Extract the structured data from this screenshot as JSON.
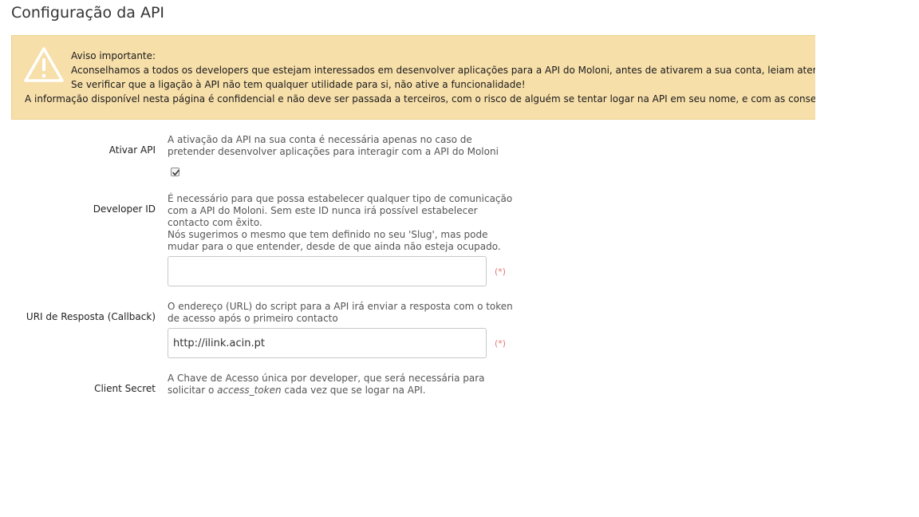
{
  "page": {
    "title": "Configuração da API"
  },
  "warning": {
    "icon": "warning-triangle-icon",
    "title": "Aviso importante:",
    "line1": "Aconselhamos a todos os developers que estejam interessados em desenvolver aplicações para a API do Moloni, antes de ativarem a sua conta, leiam atentamente",
    "line2": "Se verificar que a ligação à API não tem qualquer utilidade para si, não ative a funcionalidade!",
    "line3": "A informação disponível nesta página é confidencial e não deve ser passada a terceiros, com o risco de alguém se tentar logar na API em seu nome, e com as consequências"
  },
  "fields": {
    "activate": {
      "label": "Ativar API",
      "help_line1": "A ativação da API na sua conta é necessária apenas no caso de",
      "help_line2": "pretender desenvolver aplicações para interagir com a API do Moloni",
      "checked": true
    },
    "developer_id": {
      "label": "Developer ID",
      "help_line1": "É necessário para que possa estabelecer qualquer tipo de comunicação",
      "help_line2": "com a API do Moloni. Sem este ID nunca irá possível estabelecer",
      "help_line3": "contacto com êxito.",
      "help_line4": "Nós sugerimos o mesmo que tem definido no seu 'Slug', mas pode",
      "help_line5": "mudar para o que entender, desde de que ainda não esteja ocupado.",
      "value": "",
      "required_mark": "(*)"
    },
    "callback": {
      "label": "URI de Resposta (Callback)",
      "help_line1": "O endereço (URL) do script para a API irá enviar a resposta com o token",
      "help_line2": "de acesso após o primeiro contacto",
      "value": "http://ilink.acin.pt",
      "required_mark": "(*)"
    },
    "client_secret": {
      "label": "Client Secret",
      "help_line1": "A Chave de Acesso única por developer, que será necessária para",
      "help_line2_pre": "solicitar o ",
      "help_line2_em": "access_token",
      "help_line2_post": " cada vez que se logar na API."
    }
  },
  "colors": {
    "warning_background": "#f7dfaa",
    "required_mark": "#e47a74"
  }
}
